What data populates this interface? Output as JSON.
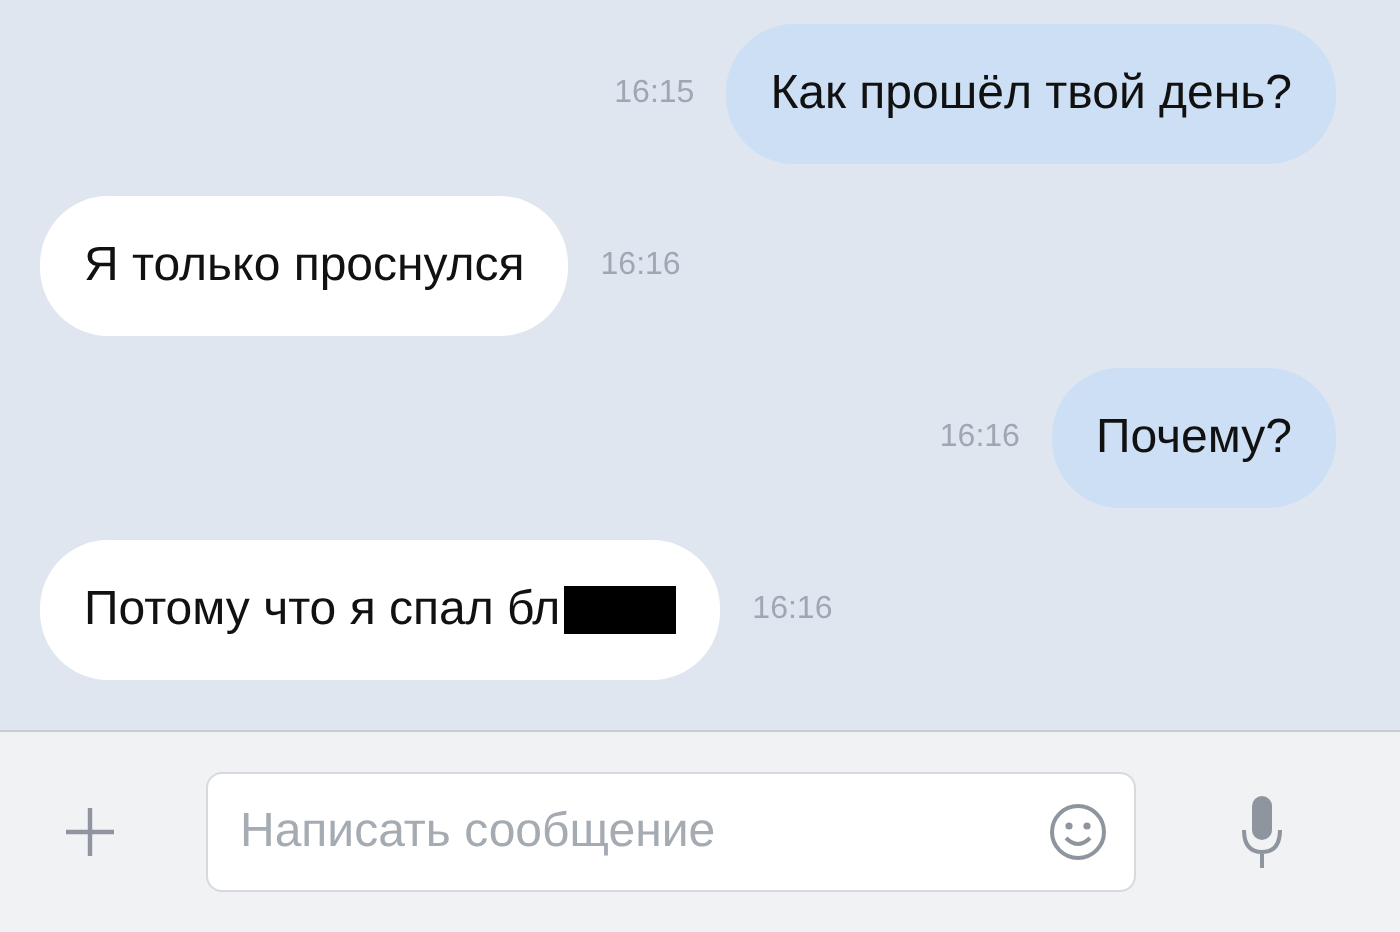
{
  "messages": [
    {
      "kind": "outgoing",
      "text": "Как прошёл твой день?",
      "time": "16:15"
    },
    {
      "kind": "incoming",
      "text": "Я только проснулся",
      "time": "16:16"
    },
    {
      "kind": "outgoing",
      "text": "Почему?",
      "time": "16:16"
    },
    {
      "kind": "incoming",
      "text": "Потому что я спал бл",
      "time": "16:16",
      "redacted": true
    }
  ],
  "composer": {
    "placeholder": "Написать сообщение"
  }
}
